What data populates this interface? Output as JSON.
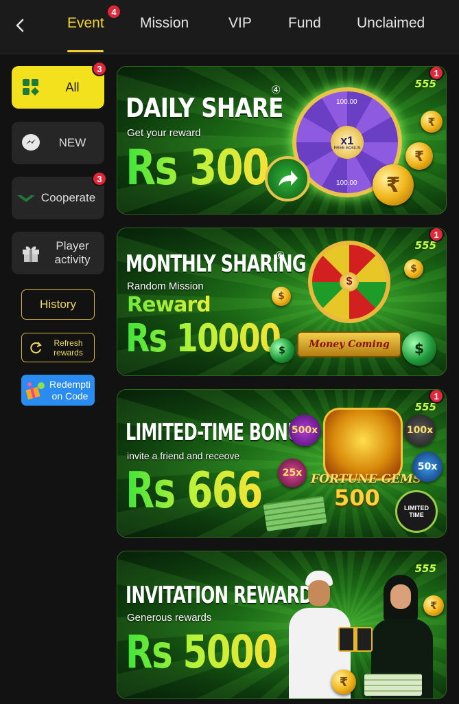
{
  "tabs": [
    {
      "label": "Event",
      "badge": "4",
      "active": true
    },
    {
      "label": "Mission"
    },
    {
      "label": "VIP"
    },
    {
      "label": "Fund"
    },
    {
      "label": "Unclaimed"
    }
  ],
  "sidebar": {
    "items": [
      {
        "label": "All",
        "badge": "3",
        "icon": "grid-icon",
        "active": true
      },
      {
        "label": "NEW",
        "icon": "messenger-icon"
      },
      {
        "label": "Cooperate",
        "badge": "3",
        "icon": "cooperate-icon"
      },
      {
        "label": "Player activity",
        "icon": "gift-icon"
      }
    ],
    "history_label": "History",
    "refresh_label": "Refresh rewards",
    "redeem_label": "Redemption Code"
  },
  "banners": [
    {
      "title": "DAILY SHARE",
      "number": "④",
      "subtitle": "Get your reward",
      "amount": "Rs 300",
      "badge": "1",
      "logo": "555"
    },
    {
      "title": "MONTHLY SHARING",
      "number": "⑥",
      "subtitle": "Random Mission",
      "reward_label": "Reward",
      "amount": "Rs 10000",
      "badge": "1",
      "logo": "555",
      "sign": "Money Coming"
    },
    {
      "title": "LIMITED-TIME BONUS",
      "subtitle": "invite a friend and receove",
      "amount": "Rs 666",
      "badge": "1",
      "logo": "555",
      "game": "FORTUNE GEMS",
      "game_number": "500",
      "stamp": "LIMITED TIME",
      "multipliers": [
        "500x",
        "100x",
        "25x",
        "50x"
      ]
    },
    {
      "title": "INVITATION REWARD",
      "subtitle": "Generous rewards",
      "amount": "Rs 5000",
      "logo": "555"
    }
  ],
  "wheel": {
    "center": "x1",
    "center_sub": "FREE BONUS",
    "segment_value": "100.00"
  },
  "colors": {
    "accent": "#f3d332",
    "badge": "#e0283a",
    "active_side": "#f3e11e",
    "redeem": "#2a8cf0"
  }
}
